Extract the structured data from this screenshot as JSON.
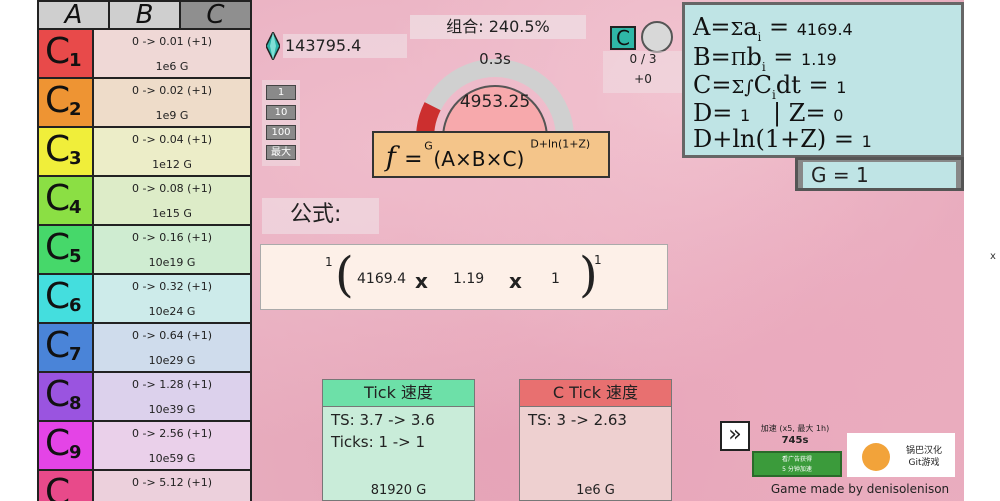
{
  "tabs": [
    "A",
    "B",
    "C"
  ],
  "c_rows": [
    {
      "label": "C",
      "sub": "1",
      "color": "#e84a4a",
      "bg": "#efd8d6",
      "line1": "0 -> 0.01 (+1)",
      "line2": "1e6 G"
    },
    {
      "label": "C",
      "sub": "2",
      "color": "#ee9433",
      "bg": "#eedcc9",
      "line1": "0 -> 0.02 (+1)",
      "line2": "1e9 G"
    },
    {
      "label": "C",
      "sub": "3",
      "color": "#f0ee3a",
      "bg": "#ecedc8",
      "line1": "0 -> 0.04 (+1)",
      "line2": "1e12 G"
    },
    {
      "label": "C",
      "sub": "4",
      "color": "#8bdf44",
      "bg": "#ddecc8",
      "line1": "0 -> 0.08 (+1)",
      "line2": "1e15 G"
    },
    {
      "label": "C",
      "sub": "5",
      "color": "#46d86a",
      "bg": "#cfecd1",
      "line1": "0 -> 0.16 (+1)",
      "line2": "10e19 G"
    },
    {
      "label": "C",
      "sub": "6",
      "color": "#44dede",
      "bg": "#cdebea",
      "line1": "0 -> 0.32 (+1)",
      "line2": "10e24 G"
    },
    {
      "label": "C",
      "sub": "7",
      "color": "#4a84d8",
      "bg": "#cfdcec",
      "line1": "0 -> 0.64 (+1)",
      "line2": "10e29 G"
    },
    {
      "label": "C",
      "sub": "8",
      "color": "#9a54e0",
      "bg": "#dcd1ec",
      "line1": "0 -> 1.28 (+1)",
      "line2": "10e39 G"
    },
    {
      "label": "C",
      "sub": "9",
      "color": "#e444e6",
      "bg": "#ead0ea",
      "line1": "0 -> 2.56 (+1)",
      "line2": "10e59 G"
    },
    {
      "label": "C",
      "sub": "",
      "color": "#e84a8a",
      "bg": "#ecd0dc",
      "line1": "0 -> 5.12 (+1)",
      "line2": ""
    }
  ],
  "resource": "143795.4",
  "combo": "组合: 240.5%",
  "multipliers": [
    "1",
    "10",
    "100",
    "最大"
  ],
  "gauge": {
    "time": "0.3s",
    "value": "4953.25",
    "progress": 0.15
  },
  "c_counter": {
    "count": "0 / 3",
    "plus": "+0"
  },
  "c_square_label": "C",
  "equations": {
    "a_val": "4169.4",
    "b_val": "1.19",
    "c_val": "1",
    "d_val": "1",
    "z_val": "0",
    "dz_val": "1"
  },
  "g_value": "G = 1",
  "gongshi": "公式:",
  "formula_box": {
    "left_exp": "1",
    "right_exp": "1",
    "a": "4169.4",
    "b": "1.19",
    "c": "1",
    "x": "x"
  },
  "tick_speed": {
    "header": "Tick 速度",
    "ts": "TS: 3.7 -> 3.6",
    "ticks": "Ticks: 1 -> 1",
    "cost": "81920 G",
    "header_color": "#6de0a8",
    "box_color": "#c9ecd9"
  },
  "c_tick_speed": {
    "header": "C Tick 速度",
    "ts": "TS: 3 -> 2.63",
    "cost": "1e6 G",
    "header_color": "#e87070",
    "box_color": "#eed0d0"
  },
  "speedup": {
    "label": "加速 (x5, 最大 1h)",
    "time": "745s",
    "ad_label": "看广告获得\n5 分钟加速"
  },
  "logo": {
    "line1": "锅巴汉化",
    "line2": "Git游戏"
  },
  "credit": "Game made by denisolenison",
  "close": "x"
}
